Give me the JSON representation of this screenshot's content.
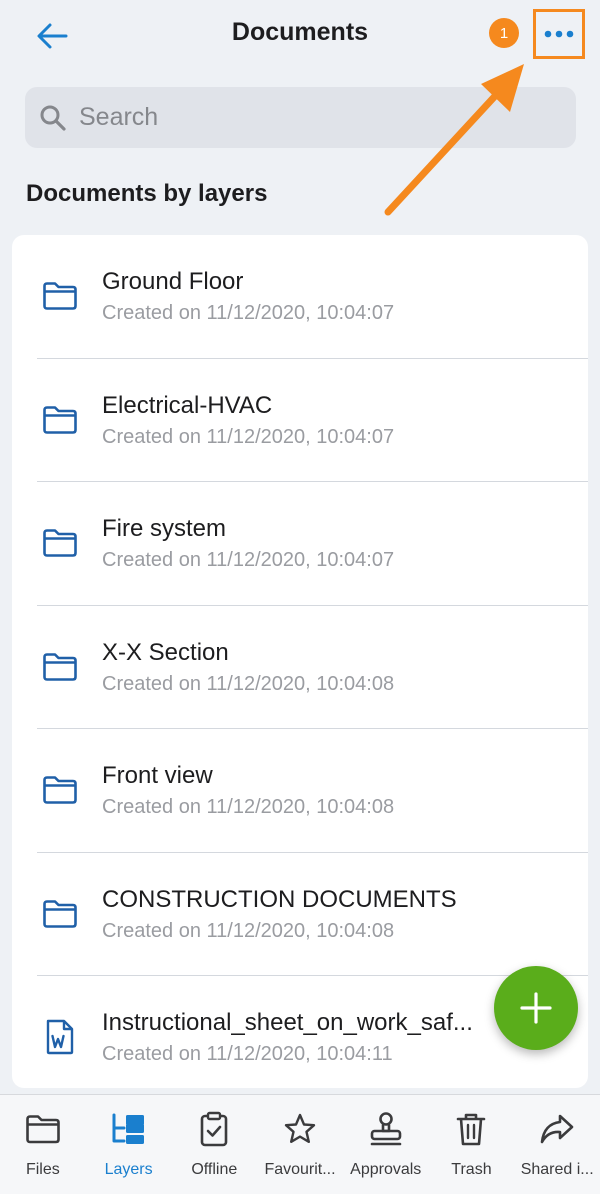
{
  "header": {
    "title": "Documents",
    "step_number": "1"
  },
  "search": {
    "placeholder": "Search"
  },
  "section_title": "Documents by layers",
  "documents": [
    {
      "name": "Ground Floor",
      "created": "Created on 11/12/2020, 10:04:07",
      "icon": "folder-icon"
    },
    {
      "name": "Electrical-HVAC",
      "created": "Created on 11/12/2020, 10:04:07",
      "icon": "folder-icon"
    },
    {
      "name": "Fire system",
      "created": "Created on 11/12/2020, 10:04:07",
      "icon": "folder-icon"
    },
    {
      "name": "X-X Section",
      "created": "Created on 11/12/2020, 10:04:08",
      "icon": "folder-icon"
    },
    {
      "name": "Front view",
      "created": "Created on 11/12/2020, 10:04:08",
      "icon": "folder-icon"
    },
    {
      "name": "CONSTRUCTION DOCUMENTS",
      "created": "Created on 11/12/2020, 10:04:08",
      "icon": "folder-icon"
    },
    {
      "name": "Instructional_sheet_on_work_saf...",
      "created": "Created on 11/12/2020, 10:04:11",
      "icon": "word-file-icon"
    }
  ],
  "tabs": [
    {
      "label": "Files",
      "icon": "folder-outline-icon",
      "active": false
    },
    {
      "label": "Layers",
      "icon": "layers-icon",
      "active": true
    },
    {
      "label": "Offline",
      "icon": "clipboard-check-icon",
      "active": false
    },
    {
      "label": "Favourit...",
      "icon": "star-icon",
      "active": false
    },
    {
      "label": "Approvals",
      "icon": "stamp-icon",
      "active": false
    },
    {
      "label": "Trash",
      "icon": "trash-icon",
      "active": false
    },
    {
      "label": "Shared i...",
      "icon": "share-icon",
      "active": false
    }
  ],
  "colors": {
    "accent": "#1a7fce",
    "highlight": "#f5891e",
    "fab": "#5aad1b",
    "background": "#eef1f5"
  }
}
